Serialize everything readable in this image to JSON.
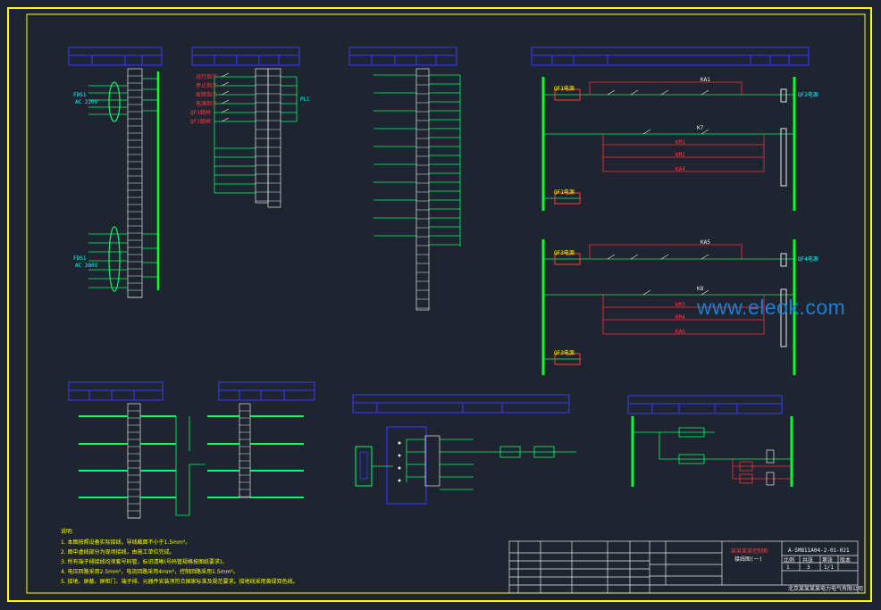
{
  "watermark": "www.eleok.com",
  "colors": {
    "background": "#1e2430",
    "frame": "#ffff00",
    "table_lines": "#3a3aff",
    "bus": "#00ff33",
    "wire_green": "#00ff66",
    "wire_red": "#ff3030",
    "wire_magenta": "#ff40ff",
    "wire_cyan": "#00ffff"
  },
  "drawing": {
    "number": "A-SM811A04-2-01-021",
    "company": "北京某某某某电力电气有限公司",
    "title_line1": "某某某某控制柜",
    "title_line2": "接线图(一)",
    "sheet_labels": [
      "比例",
      "共张",
      "第张",
      "版本"
    ],
    "sheet_values": [
      "1",
      "3",
      "1/1",
      ""
    ]
  },
  "left_block": {
    "feeder1": "AC 220V",
    "feeder2": "AC 380V",
    "feeder_name": "FDS1"
  },
  "middle_block": {
    "alarm_labels": [
      "运行指示",
      "停止指示",
      "故障指示",
      "电源指示",
      "QF1跳闸",
      "QF2跳闸"
    ],
    "output": "PLC"
  },
  "right_circuits": {
    "top": {
      "left": "QF1电源",
      "right": "QF2电源",
      "rows": [
        "KA1",
        "K7",
        "KM1",
        "KM2",
        "KA4"
      ]
    },
    "bottom": {
      "left": "QF3电源",
      "right": "QF4电源",
      "rows": [
        "KA5",
        "K8",
        "KM3",
        "KM4",
        "KA6"
      ]
    }
  },
  "notes": {
    "title": "说明:",
    "items": [
      "1.    本图按照设备实际接线，导线截面不小于1.5mm²。",
      "2.    图中虚线部分为现场接线，由施工单位完成。",
      "3.    所有端子排接线均须套号码管，标识清晰(号码管规格按图纸要求)。",
      "4.    电压回路采用2.5mm²，电流回路采用4mm²，控制回路采用1.5mm²。",
      "5.    接地、屏蔽、屏柜门、端子排、元器件安装须符合国家标准及规范要求。接地线采用黄绿双色线。"
    ]
  }
}
